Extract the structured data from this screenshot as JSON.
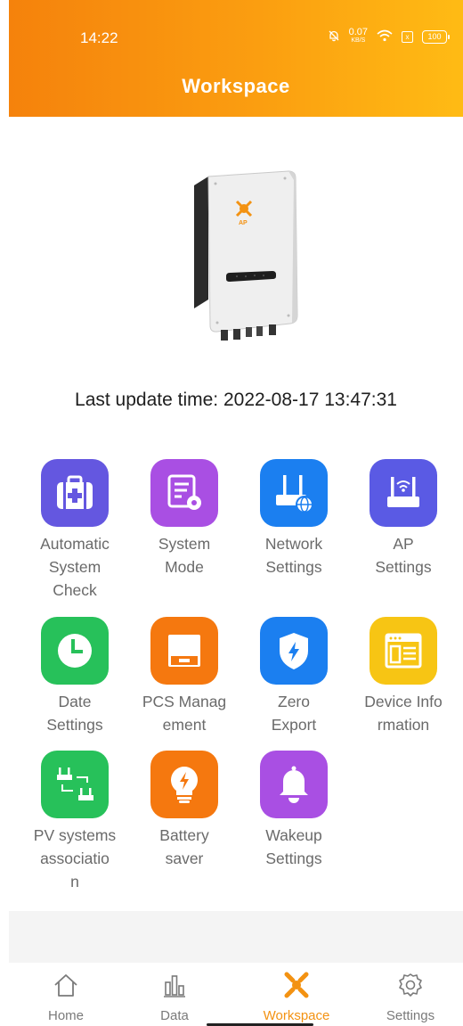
{
  "status_bar": {
    "time": "14:22",
    "net_speed_value": "0.07",
    "net_speed_unit": "KB/S",
    "battery": "100",
    "sim_label": "x"
  },
  "header": {
    "title": "Workspace"
  },
  "device": {
    "image": "inverter-device-image",
    "brand": "APsystems",
    "last_update_text": "Last update time: 2022-08-17 13:47:31"
  },
  "tiles": [
    {
      "label": "Automatic\nSystem\nCheck",
      "icon": "medical-kit-icon",
      "color": "#6457e0"
    },
    {
      "label": "System\nMode",
      "icon": "settings-document-icon",
      "color": "#a94fe3"
    },
    {
      "label": "Network\nSettings",
      "icon": "router-globe-icon",
      "color": "#1b7ff0"
    },
    {
      "label": "AP\nSettings",
      "icon": "router-wifi-icon",
      "color": "#5a5ae4"
    },
    {
      "label": "Date\nSettings",
      "icon": "clock-icon",
      "color": "#27c15a"
    },
    {
      "label": "PCS Manag\nement",
      "icon": "pcs-box-icon",
      "color": "#f5780f"
    },
    {
      "label": "Zero\nExport",
      "icon": "shield-bolt-icon",
      "color": "#1b7ff0"
    },
    {
      "label": "Device Info\nrmation",
      "icon": "browser-window-icon",
      "color": "#f7c514"
    },
    {
      "label": "PV systems\nassociatio\nn",
      "icon": "linked-routers-icon",
      "color": "#27c15a"
    },
    {
      "label": "Battery\nsaver",
      "icon": "lightbulb-icon",
      "color": "#f5780f"
    },
    {
      "label": "Wakeup\nSettings",
      "icon": "bell-icon",
      "color": "#a94fe3"
    }
  ],
  "tabbar": {
    "items": [
      {
        "label": "Home",
        "icon": "home-icon"
      },
      {
        "label": "Data",
        "icon": "bar-chart-icon"
      },
      {
        "label": "Workspace",
        "icon": "workspace-logo-icon",
        "active": true
      },
      {
        "label": "Settings",
        "icon": "gear-icon"
      }
    ],
    "accent": "#f39212"
  }
}
